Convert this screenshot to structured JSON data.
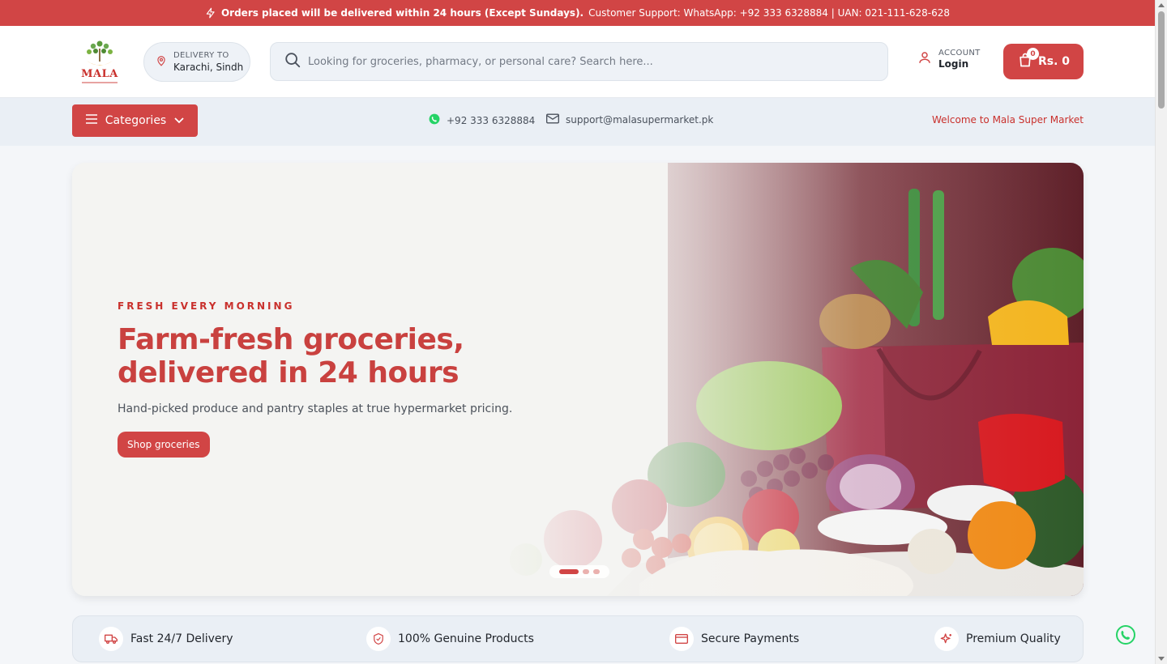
{
  "announcement": {
    "bold": "Orders placed will be delivered within 24 hours (Except Sundays).",
    "rest": "Customer Support: WhatsApp: +92 333 6328884 | UAN: 021-111-628-628"
  },
  "brand": {
    "logo_text": "MALA"
  },
  "delivery": {
    "label": "DELIVERY TO",
    "location": "Karachi, Sindh"
  },
  "search": {
    "placeholder": "Looking for groceries, pharmacy, or personal care? Search here..."
  },
  "account": {
    "label": "ACCOUNT",
    "action": "Login"
  },
  "cart": {
    "count": "0",
    "total": "Rs. 0"
  },
  "subnav": {
    "categories_label": "Categories",
    "phone": "+92 333 6328884",
    "email": "support@malasupermarket.pk",
    "welcome": "Welcome to Mala Super Market"
  },
  "hero": {
    "eyebrow": "FRESH EVERY MORNING",
    "headline_line1": "Farm-fresh groceries,",
    "headline_line2": "delivered in 24 hours",
    "subtext": "Hand-picked produce and pantry staples at true hypermarket pricing.",
    "cta": "Shop groceries",
    "slides": 3,
    "active_slide": 1
  },
  "features": [
    {
      "label": "Fast 24/7 Delivery",
      "icon": "truck-icon"
    },
    {
      "label": "100% Genuine Products",
      "icon": "shield-icon"
    },
    {
      "label": "Secure Payments",
      "icon": "card-icon"
    },
    {
      "label": "Premium Quality",
      "icon": "sparkle-icon"
    }
  ],
  "colors": {
    "brand_red": "#d14545",
    "whatsapp_green": "#25d366"
  }
}
